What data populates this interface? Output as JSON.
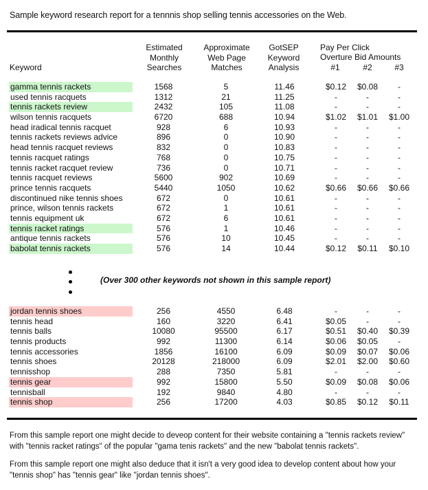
{
  "title": "Sample keyword research report for a tennnis shop selling tennis accessories on the Web.",
  "headers": {
    "keyword": "Keyword",
    "estimated": [
      "Estimated",
      "Monthly",
      "Searches"
    ],
    "approximate": [
      "Approximate",
      "Web Page",
      "Matches"
    ],
    "gotsep": [
      "GotSEP",
      "Keyword",
      "Analysis"
    ],
    "ppc_line1": "Pay Per Click",
    "ppc_line2": "Overture Bid Amounts",
    "bids": [
      "#1",
      "#2",
      "#3"
    ]
  },
  "highlight_colors": {
    "good": "#ccf7cc",
    "bad": "#ffcccc"
  },
  "top_rows": [
    {
      "keyword": "gamma tennis rackets",
      "searches": "1568",
      "matches": "5",
      "analysis": "11.46",
      "bid1": "$0.12",
      "bid2": "$0.08",
      "bid3": "-",
      "highlight": "green"
    },
    {
      "keyword": "used tennis racquets",
      "searches": "1312",
      "matches": "21",
      "analysis": "11.25",
      "bid1": "-",
      "bid2": "-",
      "bid3": "-",
      "highlight": ""
    },
    {
      "keyword": "tennis rackets review",
      "searches": "2432",
      "matches": "105",
      "analysis": "11.08",
      "bid1": "-",
      "bid2": "-",
      "bid3": "-",
      "highlight": "green"
    },
    {
      "keyword": "wilson tennis racquets",
      "searches": "6720",
      "matches": "688",
      "analysis": "10.94",
      "bid1": "$1.02",
      "bid2": "$1.01",
      "bid3": "$1.00",
      "highlight": ""
    },
    {
      "keyword": "head iradical tennis racquet",
      "searches": "928",
      "matches": "6",
      "analysis": "10.93",
      "bid1": "-",
      "bid2": "-",
      "bid3": "-",
      "highlight": ""
    },
    {
      "keyword": "tennis rackets reviews advice",
      "searches": "896",
      "matches": "0",
      "analysis": "10.90",
      "bid1": "-",
      "bid2": "-",
      "bid3": "-",
      "highlight": ""
    },
    {
      "keyword": "head tennis racquet reviews",
      "searches": "832",
      "matches": "0",
      "analysis": "10.83",
      "bid1": "-",
      "bid2": "-",
      "bid3": "-",
      "highlight": ""
    },
    {
      "keyword": "tennis racquet ratings",
      "searches": "768",
      "matches": "0",
      "analysis": "10.75",
      "bid1": "-",
      "bid2": "-",
      "bid3": "-",
      "highlight": ""
    },
    {
      "keyword": "tennis racket racquet review",
      "searches": "736",
      "matches": "0",
      "analysis": "10.71",
      "bid1": "-",
      "bid2": "-",
      "bid3": "-",
      "highlight": ""
    },
    {
      "keyword": "tennis racquet reviews",
      "searches": "5600",
      "matches": "902",
      "analysis": "10.69",
      "bid1": "-",
      "bid2": "-",
      "bid3": "-",
      "highlight": ""
    },
    {
      "keyword": "prince tennis racquets",
      "searches": "5440",
      "matches": "1050",
      "analysis": "10.62",
      "bid1": "$0.66",
      "bid2": "$0.66",
      "bid3": "$0.66",
      "highlight": ""
    },
    {
      "keyword": "discontinued nike tennis shoes",
      "searches": "672",
      "matches": "0",
      "analysis": "10.61",
      "bid1": "-",
      "bid2": "-",
      "bid3": "-",
      "highlight": ""
    },
    {
      "keyword": "prince, wilson tennis rackets",
      "searches": "672",
      "matches": "1",
      "analysis": "10.61",
      "bid1": "-",
      "bid2": "-",
      "bid3": "-",
      "highlight": ""
    },
    {
      "keyword": "tennis equipment uk",
      "searches": "672",
      "matches": "6",
      "analysis": "10.61",
      "bid1": "-",
      "bid2": "-",
      "bid3": "-",
      "highlight": ""
    },
    {
      "keyword": "tennis racket ratings",
      "searches": "576",
      "matches": "1",
      "analysis": "10.46",
      "bid1": "-",
      "bid2": "-",
      "bid3": "-",
      "highlight": "green"
    },
    {
      "keyword": "antique tennis rackets",
      "searches": "576",
      "matches": "10",
      "analysis": "10.45",
      "bid1": "-",
      "bid2": "-",
      "bid3": "-",
      "highlight": ""
    },
    {
      "keyword": "babolat tennis rackets",
      "searches": "576",
      "matches": "14",
      "analysis": "10.44",
      "bid1": "$0.12",
      "bid2": "$0.11",
      "bid3": "$0.10",
      "highlight": "green"
    }
  ],
  "omitted_note": "(Over 300 other keywords not shown in this sample report)",
  "bottom_rows": [
    {
      "keyword": "jordan tennis shoes",
      "searches": "256",
      "matches": "4550",
      "analysis": "6.48",
      "bid1": "-",
      "bid2": "-",
      "bid3": "-",
      "highlight": "red"
    },
    {
      "keyword": "tennis head",
      "searches": "160",
      "matches": "3220",
      "analysis": "6.41",
      "bid1": "$0.05",
      "bid2": "-",
      "bid3": "-",
      "highlight": ""
    },
    {
      "keyword": "tennis balls",
      "searches": "10080",
      "matches": "95500",
      "analysis": "6.17",
      "bid1": "$0.51",
      "bid2": "$0.40",
      "bid3": "$0.39",
      "highlight": ""
    },
    {
      "keyword": "tennis products",
      "searches": "992",
      "matches": "11300",
      "analysis": "6.14",
      "bid1": "$0.06",
      "bid2": "$0.05",
      "bid3": "-",
      "highlight": ""
    },
    {
      "keyword": "tennis accessories",
      "searches": "1856",
      "matches": "16100",
      "analysis": "6.09",
      "bid1": "$0.09",
      "bid2": "$0.07",
      "bid3": "$0.06",
      "highlight": ""
    },
    {
      "keyword": "tennis shoes",
      "searches": "20128",
      "matches": "218000",
      "analysis": "6.09",
      "bid1": "$2.01",
      "bid2": "$2.00",
      "bid3": "$0.60",
      "highlight": ""
    },
    {
      "keyword": "tennisshop",
      "searches": "288",
      "matches": "7350",
      "analysis": "5.81",
      "bid1": "-",
      "bid2": "-",
      "bid3": "-",
      "highlight": ""
    },
    {
      "keyword": "tennis gear",
      "searches": "992",
      "matches": "15800",
      "analysis": "5.50",
      "bid1": "$0.09",
      "bid2": "$0.08",
      "bid3": "$0.06",
      "highlight": "red"
    },
    {
      "keyword": "tennisball",
      "searches": "192",
      "matches": "9840",
      "analysis": "4.80",
      "bid1": "-",
      "bid2": "-",
      "bid3": "-",
      "highlight": ""
    },
    {
      "keyword": "tennis shop",
      "searches": "256",
      "matches": "17200",
      "analysis": "4.03",
      "bid1": "$0.85",
      "bid2": "$0.12",
      "bid3": "$0.11",
      "highlight": "red"
    }
  ],
  "notes": [
    "From this sample report one might decide to deveop content for their website containing a \"tennis rackets review\" with \"tennis racket ratings\" of the popular \"gama tenis rackets\" and the new \"babolat tennis rackets\".",
    "From this sample report one might also deduce that it isn't a very good idea to develop content  about how your \"tennis shop\" has \"tennis gear\" like \"jordan tennis shoes\"."
  ]
}
